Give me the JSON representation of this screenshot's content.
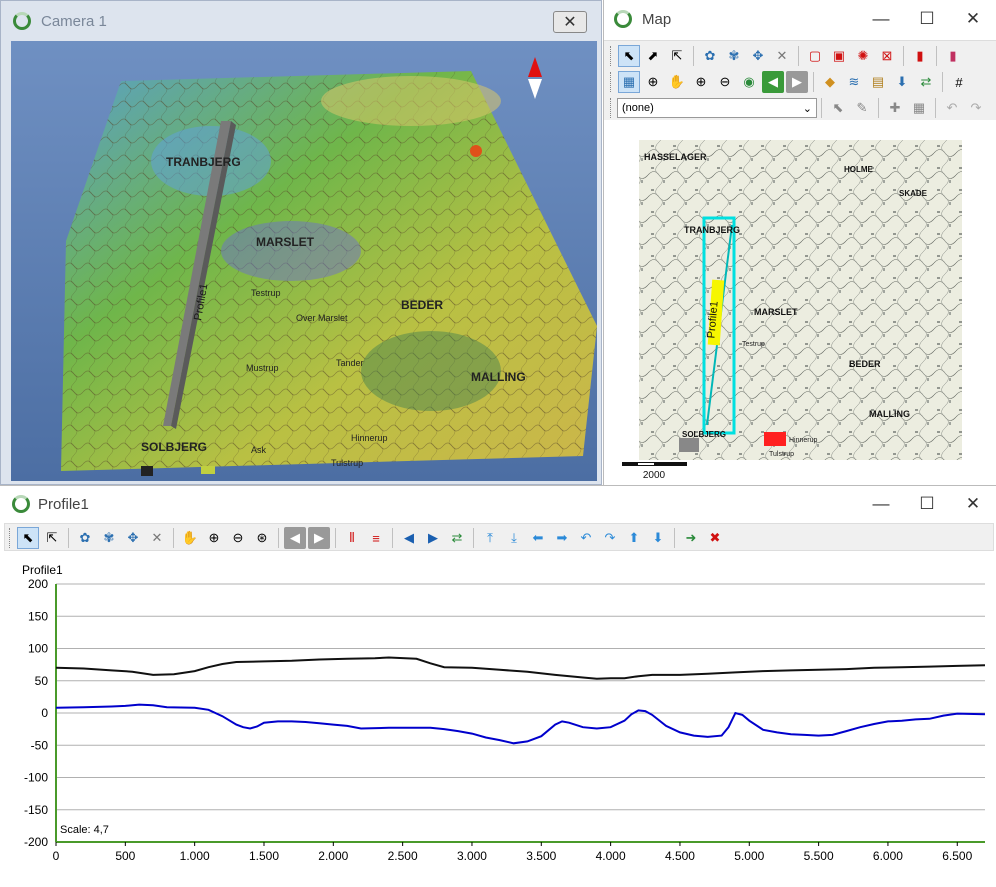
{
  "camera": {
    "title": "Camera 1",
    "map_labels": [
      "TRANBJERG",
      "MARSLET",
      "BEDER",
      "MALLING",
      "SOLBJERG",
      "Testrup",
      "Tulstrup",
      "Hinnerup",
      "Ask",
      "Tander",
      "Over Marslet",
      "Mustrup"
    ],
    "profile_label": "Profile1"
  },
  "map": {
    "title": "Map",
    "layer_select": "(none)",
    "scale_label": "2000",
    "profile_label": "Profile1",
    "labels": [
      "HASSELAGER",
      "TRANBJERG",
      "MARSLET",
      "BEDER",
      "MALLING",
      "SOLBJERG",
      "HOLME",
      "SKADE",
      "Testrup",
      "Tulstrup",
      "Hinnerup"
    ]
  },
  "profile": {
    "title": "Profile1",
    "chart_title": "Profile1",
    "scale_text": "Scale: 4,7",
    "chart_data": {
      "type": "line",
      "title": "Profile1",
      "xlim": [
        0,
        6700
      ],
      "ylim": [
        -200,
        200
      ],
      "x_ticks": [
        "0",
        "500",
        "1.000",
        "1.500",
        "2.000",
        "2.500",
        "3.000",
        "3.500",
        "4.000",
        "4.500",
        "5.000",
        "5.500",
        "6.000",
        "6.500"
      ],
      "y_ticks": [
        "200",
        "150",
        "100",
        "50",
        "0",
        "-50",
        "-100",
        "-150",
        "-200"
      ],
      "grid": true,
      "series": [
        {
          "color": "#111111",
          "x": [
            0,
            200,
            400,
            550,
            700,
            850,
            1000,
            1100,
            1200,
            1300,
            1500,
            1700,
            1900,
            2100,
            2300,
            2400,
            2600,
            2700,
            2800,
            3000,
            3200,
            3400,
            3600,
            3800,
            3900,
            4000,
            4100,
            4200,
            4300,
            4500,
            4700,
            4900,
            5100,
            5300,
            5500,
            5700,
            5900,
            6100,
            6300,
            6500,
            6700
          ],
          "y": [
            70,
            69,
            66,
            64,
            59,
            60,
            65,
            71,
            76,
            79,
            80,
            81,
            83,
            84,
            85,
            86,
            84,
            77,
            71,
            70,
            67,
            64,
            59,
            55,
            53,
            54,
            54,
            57,
            59,
            59,
            61,
            63,
            65,
            66,
            67,
            68,
            70,
            71,
            72,
            73,
            74
          ]
        },
        {
          "color": "#0000cc",
          "x": [
            0,
            200,
            400,
            500,
            600,
            700,
            800,
            1000,
            1100,
            1200,
            1300,
            1350,
            1400,
            1450,
            1500,
            1600,
            1700,
            1800,
            1900,
            2000,
            2100,
            2200,
            2400,
            2600,
            2700,
            2800,
            2900,
            3000,
            3100,
            3200,
            3300,
            3400,
            3500,
            3600,
            3650,
            3700,
            3800,
            3900,
            4000,
            4100,
            4150,
            4200,
            4250,
            4300,
            4400,
            4500,
            4600,
            4700,
            4800,
            4850,
            4900,
            4950,
            5000,
            5100,
            5200,
            5300,
            5400,
            5500,
            5600,
            5700,
            5800,
            5900,
            6000,
            6100,
            6200,
            6300,
            6400,
            6500,
            6700
          ],
          "y": [
            8,
            9,
            10,
            11,
            13,
            12,
            9,
            8,
            5,
            -5,
            -18,
            -22,
            -24,
            -21,
            -15,
            -13,
            -13,
            -14,
            -16,
            -18,
            -20,
            -24,
            -23,
            -23,
            -23,
            -25,
            -28,
            -32,
            -38,
            -42,
            -47,
            -44,
            -36,
            -18,
            -13,
            -15,
            -22,
            -24,
            -22,
            -12,
            -2,
            4,
            3,
            -3,
            -20,
            -30,
            -35,
            -37,
            -35,
            -22,
            0,
            -3,
            -12,
            -26,
            -30,
            -33,
            -34,
            -35,
            -34,
            -28,
            -22,
            -17,
            -13,
            -12,
            -10,
            -9,
            -4,
            -1,
            -2
          ]
        }
      ]
    }
  },
  "colors": {
    "terrain_low": "#2f8fbf",
    "terrain_mid": "#7cbf3e",
    "terrain_high": "#d9c23a",
    "profile_cyan": "#00e0e0",
    "sky": "#5a7db0"
  }
}
